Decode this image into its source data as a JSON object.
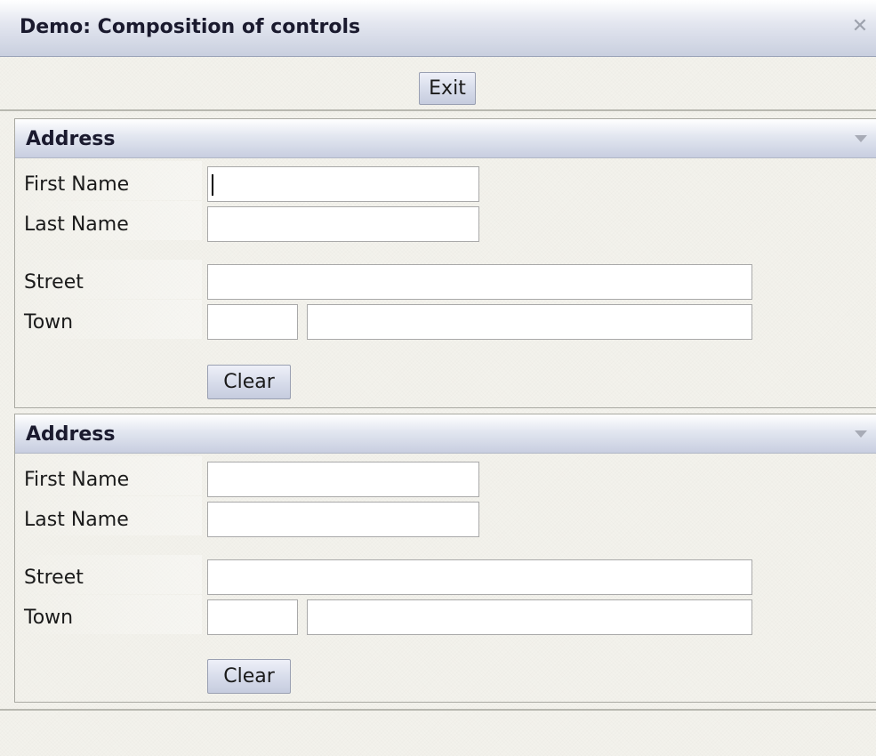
{
  "window": {
    "title": "Demo: Composition of controls",
    "close_glyph": "✕"
  },
  "toolbar": {
    "exit_label": "Exit"
  },
  "panels": [
    {
      "title": "Address",
      "labels": {
        "first_name": "First Name",
        "last_name": "Last Name",
        "street": "Street",
        "town": "Town"
      },
      "values": {
        "first_name": "",
        "last_name": "",
        "street": "",
        "zip": "",
        "town": ""
      },
      "clear_label": "Clear",
      "focused_field": "first_name"
    },
    {
      "title": "Address",
      "labels": {
        "first_name": "First Name",
        "last_name": "Last Name",
        "street": "Street",
        "town": "Town"
      },
      "values": {
        "first_name": "",
        "last_name": "",
        "street": "",
        "zip": "",
        "town": ""
      },
      "clear_label": "Clear"
    }
  ],
  "icons": {
    "close": "close-icon",
    "collapse": "chevron-down-icon"
  }
}
